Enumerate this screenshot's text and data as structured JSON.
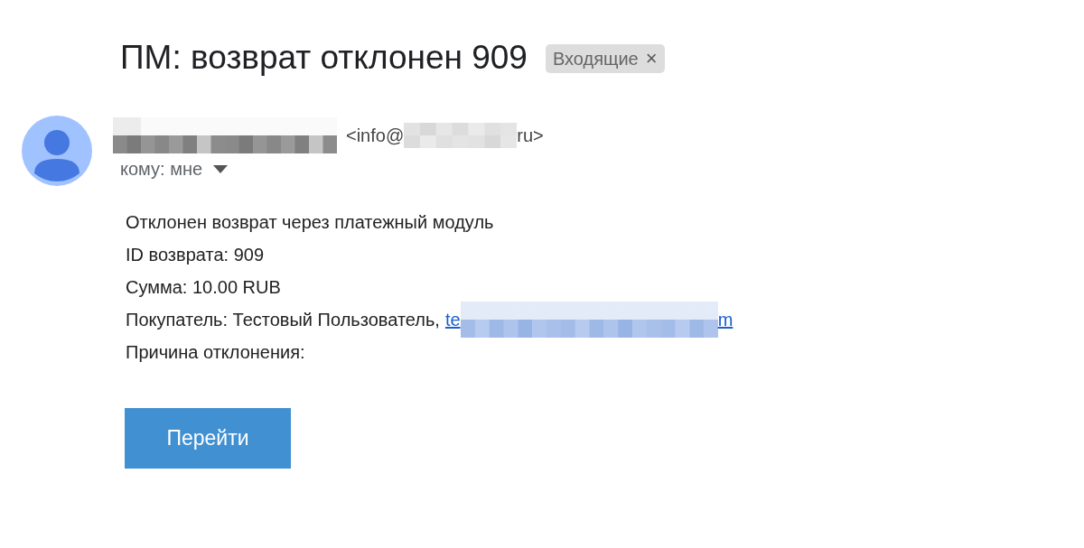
{
  "subject": "ПМ: возврат отклонен 909",
  "label": {
    "text": "Входящие",
    "close": "×"
  },
  "sender": {
    "email_start": "<info@",
    "email_end": "ru>"
  },
  "recipient": {
    "text": "кому: мне",
    "expanded": false
  },
  "body": {
    "lines": [
      {
        "kind": "text",
        "text": "Отклонен возврат через платежный модуль"
      },
      {
        "kind": "text",
        "text": "ID возврата: 909"
      },
      {
        "kind": "text",
        "text": "Сумма: 10.00 RUB"
      },
      {
        "kind": "buyer",
        "text": "Покупатель: Тестовый Пользователь,",
        "link_start": "te",
        "link_end": "m"
      },
      {
        "kind": "text",
        "text": "Причина отклонения:"
      }
    ]
  },
  "button": {
    "label": "Перейти"
  }
}
